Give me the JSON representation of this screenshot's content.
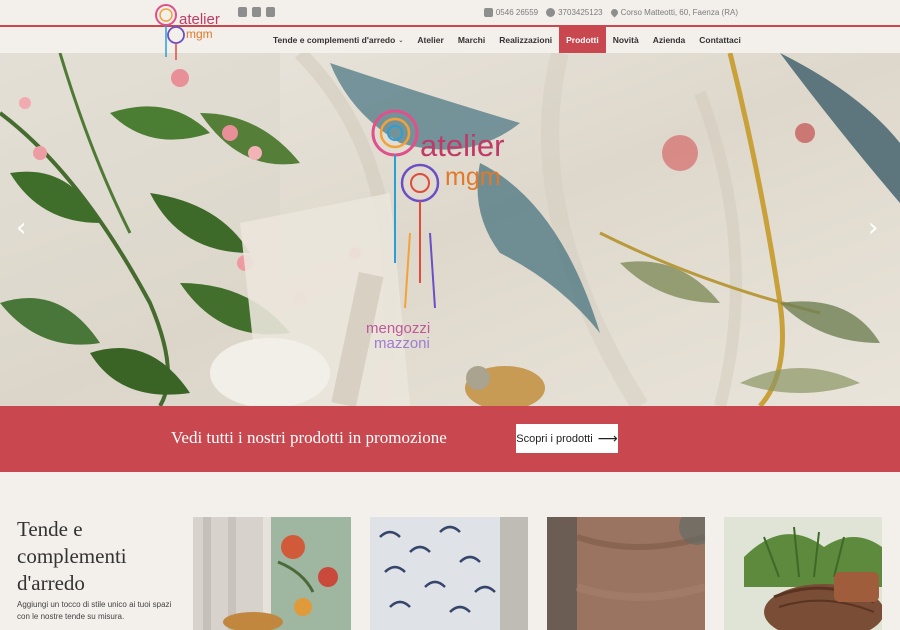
{
  "brand": {
    "logo_text_1": "atelier",
    "logo_text_2": "mgm",
    "logo_text_3": "mengozzi",
    "logo_text_4": "mazzoni"
  },
  "topbar": {
    "social": [
      "facebook-icon",
      "instagram-icon",
      "pinterest-icon"
    ],
    "phone": "0546 26559",
    "whatsapp": "3703425123",
    "address": "Corso Matteotti, 60, Faenza (RA)"
  },
  "nav": {
    "items": [
      {
        "label": "Tende e complementi d'arredo",
        "dropdown": true
      },
      {
        "label": "Atelier"
      },
      {
        "label": "Marchi"
      },
      {
        "label": "Realizzazioni"
      },
      {
        "label": "Prodotti",
        "active": true
      },
      {
        "label": "Novità"
      },
      {
        "label": "Azienda"
      },
      {
        "label": "Contattaci"
      }
    ]
  },
  "hero": {
    "prev": "‹",
    "next": "›"
  },
  "promo": {
    "text": "Vedi tutti i nostri prodotti in promozione",
    "button": "Scopri i prodotti",
    "arrow": "⟶"
  },
  "section": {
    "title": "Tende e complementi d'arredo",
    "description": "Aggiungi un tocco di stile unico ai tuoi spazi con le nostre tende su misura."
  },
  "colors": {
    "accent": "#c9484f",
    "background": "#f3efeb"
  }
}
